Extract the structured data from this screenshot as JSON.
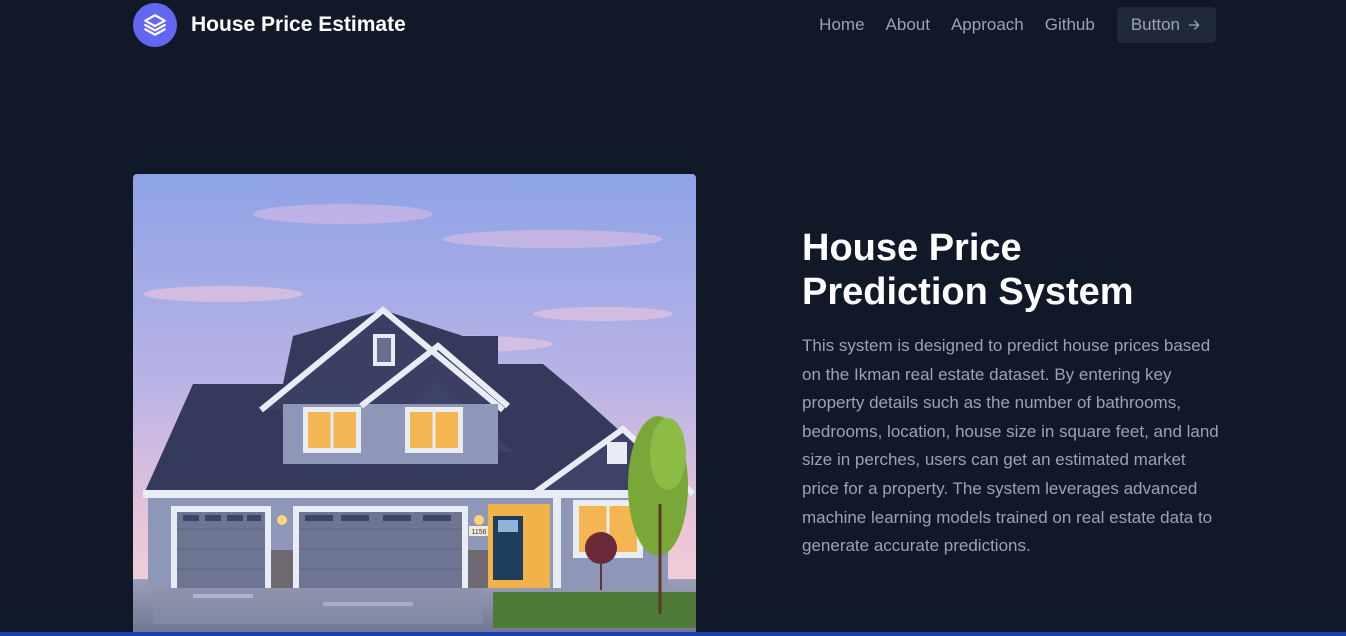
{
  "brand": {
    "title": "House Price Estimate",
    "icon": "layers-icon",
    "accent": "#6366f1"
  },
  "nav": {
    "links": [
      {
        "label": "Home"
      },
      {
        "label": "About"
      },
      {
        "label": "Approach"
      },
      {
        "label": "Github"
      }
    ],
    "button": {
      "label": "Button",
      "icon": "arrow-right-icon"
    }
  },
  "hero": {
    "image": "house-photo",
    "house_number": "1156",
    "headline_line1": "House Price",
    "headline_line2": "Prediction System",
    "description": "This system is designed to predict house prices based on the Ikman real estate dataset. By entering key property details such as the number of bathrooms, bedrooms, location, house size in square feet, and land size in perches, users can get an estimated market price for a property. The system leverages advanced machine learning models trained on real estate data to generate accurate predictions."
  },
  "colors": {
    "background": "#111827",
    "muted_text": "#9ca3af",
    "button_bg": "#1f2937"
  }
}
